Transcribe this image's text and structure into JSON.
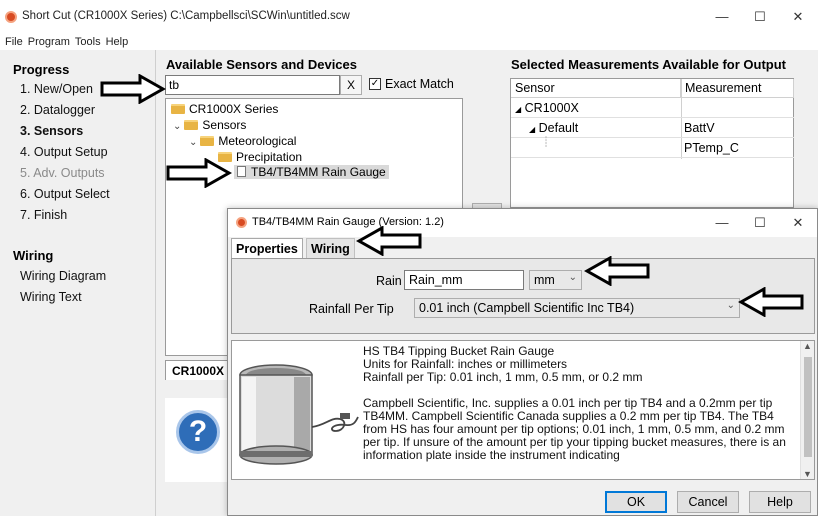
{
  "window": {
    "title": "Short Cut (CR1000X Series) C:\\Campbellsci\\SCWin\\untitled.scw",
    "minimize": "—",
    "maximize": "☐",
    "close": "✕"
  },
  "menu": [
    "File",
    "Program",
    "Tools",
    "Help"
  ],
  "progress": {
    "heading": "Progress",
    "steps": [
      "1. New/Open",
      "2. Datalogger",
      "3. Sensors",
      "4. Output Setup",
      "5. Adv. Outputs",
      "6. Output Select",
      "7. Finish"
    ],
    "current_step": "3. Sensors",
    "disabled_step": "5. Adv. Outputs"
  },
  "wiring": {
    "heading": "Wiring",
    "items": [
      "Wiring Diagram",
      "Wiring Text"
    ]
  },
  "sensors": {
    "heading": "Available Sensors and Devices",
    "search_value": "tb",
    "clear_label": "X",
    "exact_match_label": "Exact Match",
    "exact_match_checked": "✓",
    "tree": [
      "CR1000X Series",
      "Sensors",
      "Meteorological",
      "Precipitation",
      "TB4/TB4MM Rain Gauge"
    ],
    "bottom_tab": "CR1000X"
  },
  "output": {
    "heading": "Selected Measurements Available for Output",
    "columns": [
      "Sensor",
      "Measurement"
    ],
    "rows": [
      {
        "sensor": "CR1000X",
        "measurement": ""
      },
      {
        "sensor": "Default",
        "measurement": "BattV"
      },
      {
        "sensor": "",
        "measurement": "PTemp_C"
      }
    ]
  },
  "dialog": {
    "title": "TB4/TB4MM Rain Gauge (Version: 1.2)",
    "minimize": "—",
    "maximize": "☐",
    "close": "✕",
    "tabs": [
      "Properties",
      "Wiring"
    ],
    "rain_label": "Rain",
    "rain_value": "Rain_mm",
    "unit_value": "mm",
    "tip_label": "Rainfall Per Tip",
    "tip_value": "0.01 inch (Campbell Scientific Inc TB4)",
    "description": [
      "HS TB4 Tipping Bucket Rain Gauge",
      "Units for Rainfall: inches or millimeters",
      "Rainfall per Tip: 0.01 inch, 1 mm, 0.5 mm, or 0.2 mm",
      "",
      "Campbell Scientific, Inc. supplies a 0.01 inch per tip TB4 and a 0.2mm per tip TB4MM. Campbell Scientific Canada supplies a 0.2 mm per tip TB4. The TB4 from HS has four amount per tip options; 0.01 inch, 1 mm, 0.5 mm, and 0.2 mm per tip. If unsure of the amount per tip your tipping bucket measures, there is an information plate inside the instrument indicating"
    ],
    "ok_label": "OK",
    "cancel_label": "Cancel",
    "help_label": "Help"
  },
  "help_icon_glyph": "?",
  "icons": [
    "app-logo-icon",
    "folder-icon",
    "document-icon",
    "help-icon",
    "rain-gauge-image",
    "callout-arrow"
  ]
}
